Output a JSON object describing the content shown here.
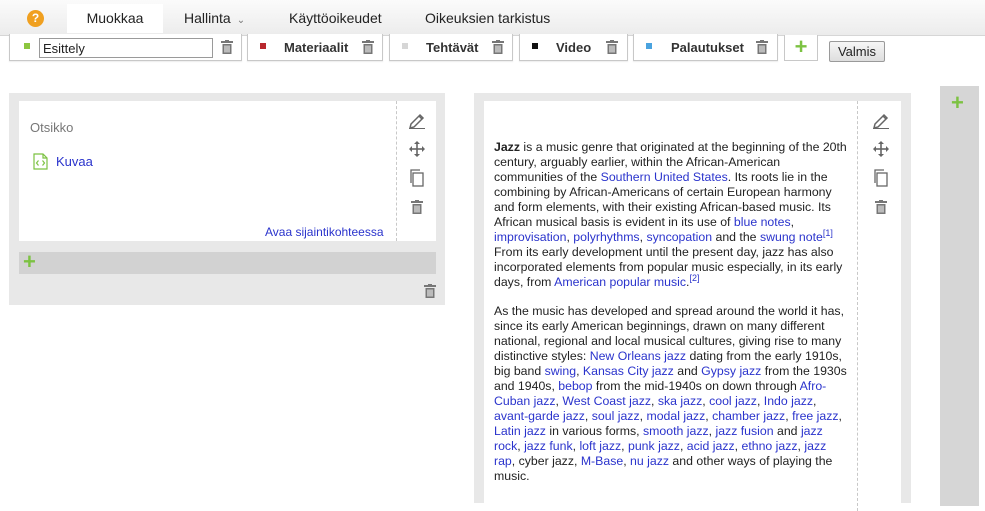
{
  "topnav": {
    "help_icon": "?",
    "tabs": [
      {
        "label": "Muokkaa",
        "active": true
      },
      {
        "label": "Hallinta",
        "dropdown": true
      },
      {
        "label": "Käyttöoikeudet"
      },
      {
        "label": "Oikeuksien tarkistus"
      }
    ],
    "chevron": "⌄"
  },
  "sections": {
    "active_value": "Esittely",
    "items": [
      {
        "label": "Materiaalit",
        "color": "#b8282e"
      },
      {
        "label": "Tehtävät",
        "color": "#d6d6d6"
      },
      {
        "label": "Video",
        "color": "#111111"
      },
      {
        "label": "Palautukset",
        "color": "#4aa3df"
      }
    ],
    "active_color": "#8cc63f",
    "add_label": "+",
    "done_label": "Valmis"
  },
  "left_block": {
    "title": "Otsikko",
    "embed_label": "Kuvaa",
    "open_link": "Avaa sijaintikohteessa",
    "add_label": "+"
  },
  "right_column": {
    "add_label": "+"
  },
  "icons": {
    "edit": "pencil-icon",
    "move": "move-icon",
    "copy": "copy-icon",
    "delete": "trash-icon",
    "embed": "code-file-icon"
  },
  "accent_colors": {
    "link": "#2a33cc",
    "add": "#7cc242",
    "help": "#f0a020"
  },
  "article": {
    "p1": [
      {
        "b": "Jazz"
      },
      {
        "t": " is a music genre that originated at the beginning of the 20th century, arguably earlier, within the African-American communities of the "
      },
      {
        "a": "Southern United States"
      },
      {
        "t": ". Its roots lie in the combining by African-Americans of certain European harmony and form elements, with their existing African-based music. Its African musical basis is evident in its use of "
      },
      {
        "a": "blue notes"
      },
      {
        "t": ", "
      },
      {
        "a": "improvisation"
      },
      {
        "t": ", "
      },
      {
        "a": "polyrhythms"
      },
      {
        "t": ", "
      },
      {
        "a": "syncopation"
      },
      {
        "t": " and the "
      },
      {
        "a": "swung note"
      },
      {
        "s": "[1]"
      },
      {
        "t": " From its early development until the present day, jazz has also incorporated elements from popular music especially, in its early days, from "
      },
      {
        "a": "American popular music"
      },
      {
        "t": "."
      },
      {
        "s": "[2]"
      }
    ],
    "p2": [
      {
        "t": "As the music has developed and spread around the world it has, since its early American beginnings, drawn on many different national, regional and local musical cultures, giving rise to many distinctive styles: "
      },
      {
        "a": "New Orleans jazz"
      },
      {
        "t": " dating from the early 1910s, big band "
      },
      {
        "a": "swing"
      },
      {
        "t": ", "
      },
      {
        "a": "Kansas City jazz"
      },
      {
        "t": " and "
      },
      {
        "a": "Gypsy jazz"
      },
      {
        "t": " from the 1930s and 1940s, "
      },
      {
        "a": "bebop"
      },
      {
        "t": " from the mid-1940s on down through "
      },
      {
        "a": "Afro-Cuban jazz"
      },
      {
        "t": ", "
      },
      {
        "a": "West Coast jazz"
      },
      {
        "t": ", "
      },
      {
        "a": "ska jazz"
      },
      {
        "t": ", "
      },
      {
        "a": "cool jazz"
      },
      {
        "t": ", "
      },
      {
        "a": "Indo jazz"
      },
      {
        "t": ", "
      },
      {
        "a": "avant-garde jazz"
      },
      {
        "t": ", "
      },
      {
        "a": "soul jazz"
      },
      {
        "t": ", "
      },
      {
        "a": "modal jazz"
      },
      {
        "t": ", "
      },
      {
        "a": "chamber jazz"
      },
      {
        "t": ", "
      },
      {
        "a": "free jazz"
      },
      {
        "t": ", "
      },
      {
        "a": "Latin jazz"
      },
      {
        "t": " in various forms, "
      },
      {
        "a": "smooth jazz"
      },
      {
        "t": ", "
      },
      {
        "a": "jazz fusion"
      },
      {
        "t": " and "
      },
      {
        "a": "jazz rock"
      },
      {
        "t": ", "
      },
      {
        "a": "jazz funk"
      },
      {
        "t": ", "
      },
      {
        "a": "loft jazz"
      },
      {
        "t": ", "
      },
      {
        "a": "punk jazz"
      },
      {
        "t": ", "
      },
      {
        "a": "acid jazz"
      },
      {
        "t": ", "
      },
      {
        "a": "ethno jazz"
      },
      {
        "t": ", "
      },
      {
        "a": "jazz rap"
      },
      {
        "t": ", cyber jazz, "
      },
      {
        "a": "M-Base"
      },
      {
        "t": ", "
      },
      {
        "a": "nu jazz"
      },
      {
        "t": " and other ways of playing the music."
      }
    ]
  }
}
